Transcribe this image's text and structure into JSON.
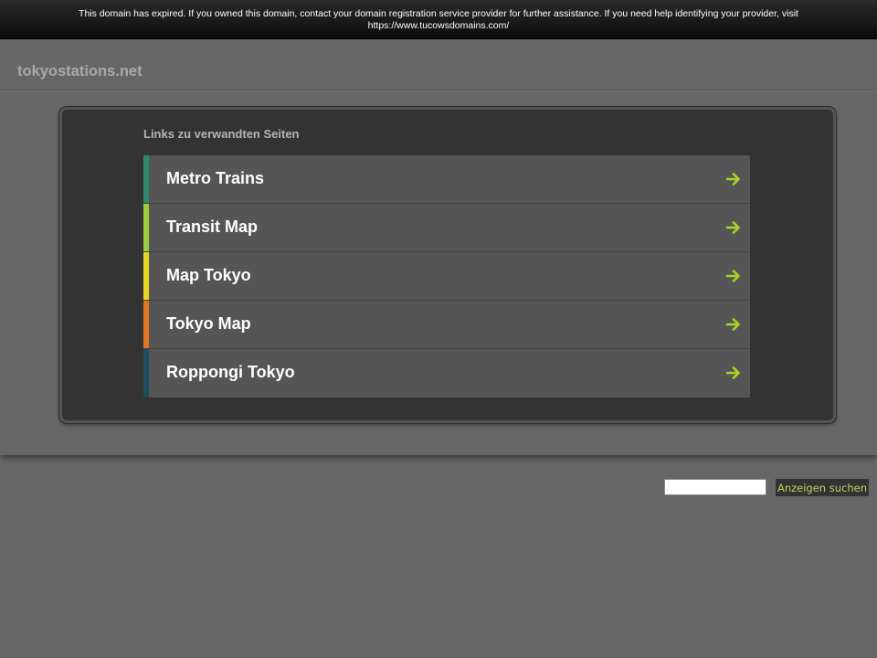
{
  "notice": {
    "line1": "This domain has expired. If you owned this domain, contact your domain registration service provider for further assistance. If you need help identifying your provider, visit",
    "line2": "https://www.tucowsdomains.com/"
  },
  "header": {
    "domain": "tokyostations.net"
  },
  "related": {
    "heading": "Links zu verwandten Seiten",
    "items": [
      {
        "label": "Metro Trains",
        "accent": "#2e8a6e"
      },
      {
        "label": "Transit Map",
        "accent": "#9ccc3c"
      },
      {
        "label": "Map Tokyo",
        "accent": "#e6d625"
      },
      {
        "label": "Tokyo Map",
        "accent": "#e0761f"
      },
      {
        "label": "Roppongi Tokyo",
        "accent": "#1d4d5e"
      }
    ],
    "arrow_icon": "arrow-right-icon",
    "arrow_color": "#a6d623"
  },
  "search": {
    "placeholder": "",
    "button_label": "Anzeigen suchen"
  }
}
